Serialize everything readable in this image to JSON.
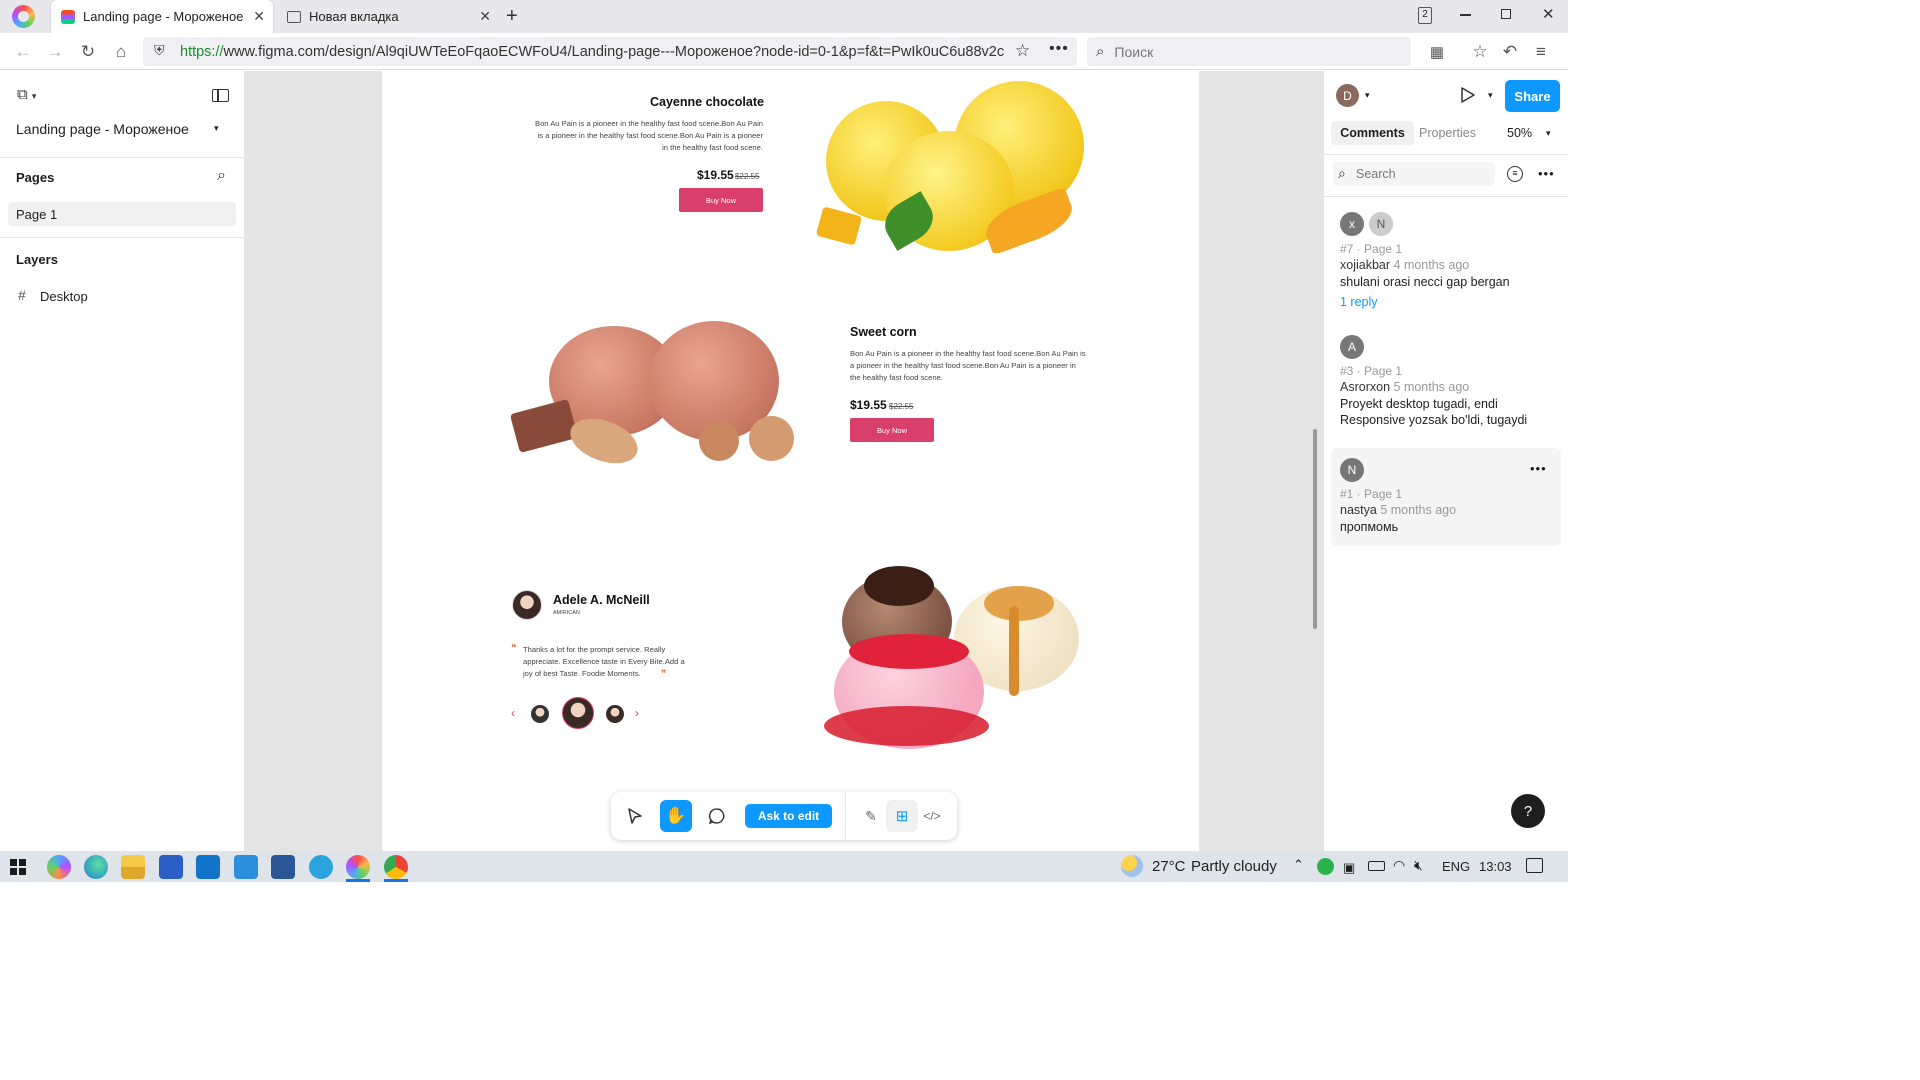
{
  "browser": {
    "tabs": [
      {
        "title": "Landing page - Мороженое"
      },
      {
        "title": "Новая вкладка"
      }
    ],
    "window_badge": "2",
    "url_prefix": "https://",
    "url_rest": "www.figma.com/design/Al9qiUWTeEoFqaoECWFoU4/Landing-page---Мороженое?node-id=0-1&p=f&t=PwIk0uC6u88v2c",
    "search_placeholder": "Поиск"
  },
  "figma_left": {
    "file_name": "Landing page - Мороженое",
    "pages_label": "Pages",
    "pages": [
      "Page 1"
    ],
    "layers_label": "Layers",
    "layers": [
      "Desktop"
    ]
  },
  "design": {
    "products": [
      {
        "title": "Cayenne chocolate",
        "desc": "Bon Au Pain is a pioneer in the healthy fast food scene.Bon Au Pain is a pioneer in the healthy fast food scene.Bon Au Pain is a pioneer in the healthy fast food scene.",
        "price": "$19.55",
        "old_price": "$22.55",
        "button": "Buy Now"
      },
      {
        "title": "Sweet corn",
        "desc": "Bon Au Pain is a pioneer in the healthy fast food scene.Bon Au Pain is a pioneer in the healthy fast food scene.Bon Au Pain is a pioneer in the healthy fast food scene.",
        "price": "$19.55",
        "old_price": "$22.55",
        "button": "Buy Now"
      }
    ],
    "testimonial": {
      "name": "Adele A. McNeill",
      "origin": "AMIRICAN",
      "quote": "Thanks a lot for the prompt service. Really appreciate. Excellence taste in Every Bite.Add a joy of best Taste. Foodie Moments."
    }
  },
  "toolbar": {
    "ask_to_edit": "Ask to edit"
  },
  "figma_right": {
    "avatar_letter": "D",
    "share": "Share",
    "tabs": [
      "Comments",
      "Properties"
    ],
    "zoom": "50%",
    "search_placeholder": "Search",
    "comments": [
      {
        "avatars": [
          "x",
          "N"
        ],
        "meta": "#7 · Page 1",
        "author": "xojiakbar",
        "ago": "4 months ago",
        "body": "shulani orasi necci gap bergan",
        "reply": "1 reply"
      },
      {
        "avatars": [
          "A"
        ],
        "meta": "#3 · Page 1",
        "author": "Asrorxon",
        "ago": "5 months ago",
        "body": "Proyekt desktop tugadi, endi Responsive yozsak bo'ldi, tugaydi",
        "reply": ""
      },
      {
        "avatars": [
          "N"
        ],
        "meta": "#1 · Page 1",
        "author": "nastya",
        "ago": "5 months ago",
        "body": "пропмомь",
        "reply": ""
      }
    ],
    "help": "?"
  },
  "taskbar": {
    "temperature": "27°C",
    "weather": "Partly cloudy",
    "lang": "ENG",
    "time": "13:03"
  },
  "colors": {
    "figma_blue": "#0d99ff",
    "buy_pink": "#d8406b"
  }
}
